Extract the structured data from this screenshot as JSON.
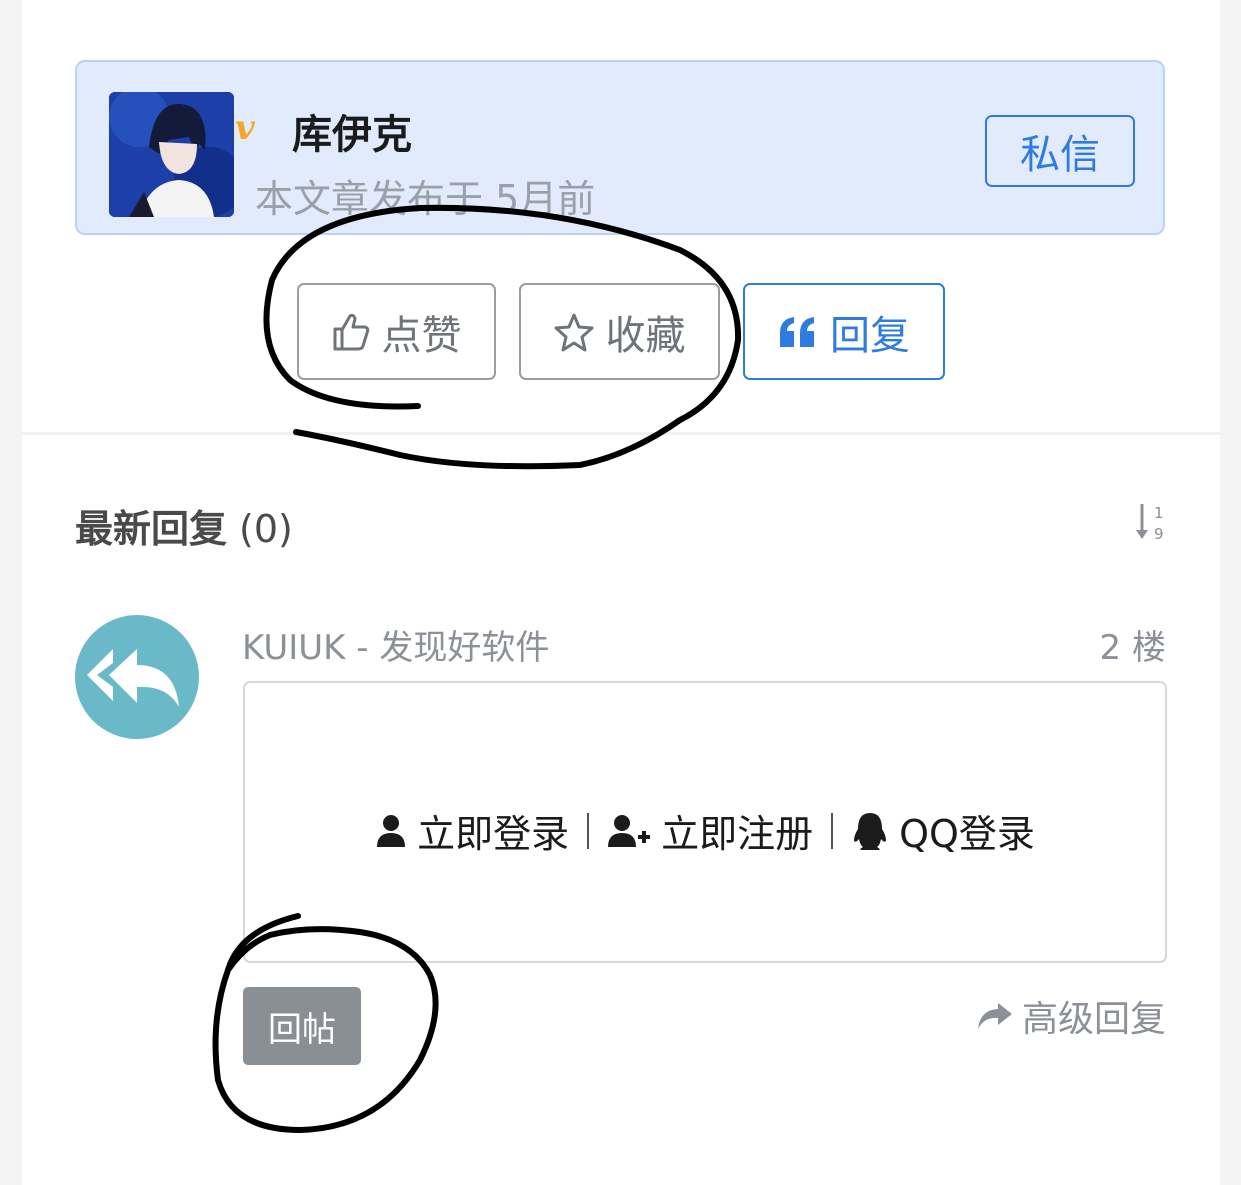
{
  "author": {
    "name": "库伊克",
    "verified_badge": "v",
    "post_time": "本文章发布于 5月前",
    "pm_label": "私信",
    "avatar_icon": "anime-avatar"
  },
  "actions": {
    "like_label": "点赞",
    "favorite_label": "收藏",
    "reply_label": "回复"
  },
  "replies": {
    "title": "最新回复",
    "count": "(0)",
    "sort_icon": "sort-numeric-icon",
    "item": {
      "author": "KUIUK - 发现好软件",
      "floor": "2 楼",
      "avatar_icon": "reply-arrow-icon"
    },
    "login": {
      "login_label": "立即登录",
      "register_label": "立即注册",
      "qq_label": "QQ登录"
    },
    "post_label": "回帖",
    "advanced_label": "高级回复"
  },
  "colors": {
    "accent": "#2e7ce0",
    "author_bg": "#e1ebfb",
    "reply_avatar": "#6ab9c9",
    "post_btn": "#8a8f96"
  }
}
